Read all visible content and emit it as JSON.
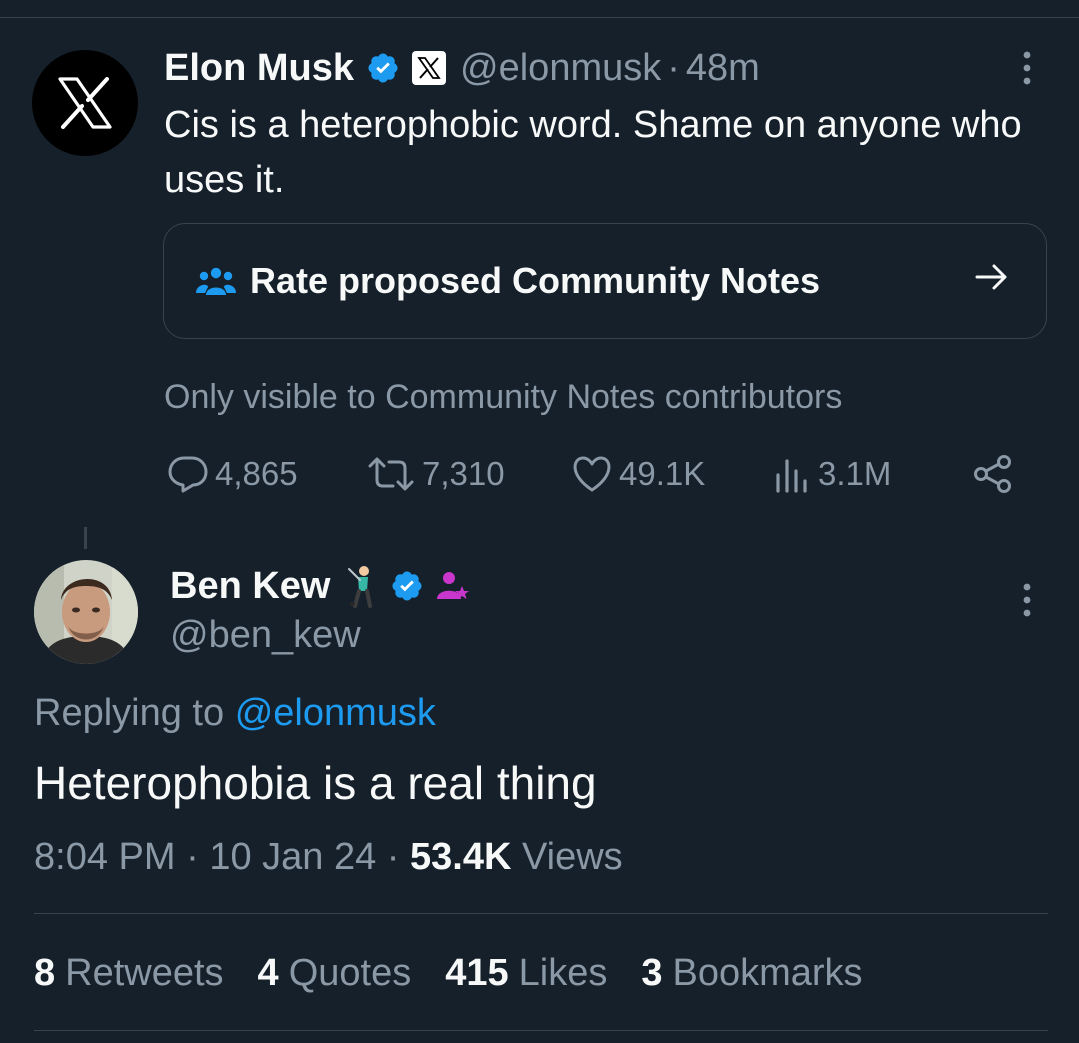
{
  "parent_tweet": {
    "author_name": "Elon Musk",
    "handle": "@elonmusk",
    "separator": "·",
    "time_ago": "48m",
    "text": "Cis is a heterophobic word. Shame on anyone who uses it.",
    "community_notes_label": "Rate proposed Community Notes",
    "visibility_note": "Only visible to Community Notes contributors",
    "actions": {
      "replies": "4,865",
      "retweets": "7,310",
      "likes": "49.1K",
      "views": "3.1M"
    },
    "icons": [
      "x-logo-icon",
      "verified-badge-icon",
      "affiliate-x-badge-icon",
      "more-options-icon",
      "community-icon",
      "arrow-right-icon",
      "reply-icon",
      "retweet-icon",
      "like-icon",
      "views-icon",
      "share-icon"
    ]
  },
  "reply_tweet": {
    "author_name": "Ben Kew",
    "handle": "@ben_kew",
    "replying_prefix": "Replying to",
    "replying_to": "@elonmusk",
    "text": "Heterophobia is a real thing",
    "time": "8:04 PM",
    "separator": "·",
    "date": "10 Jan 24",
    "views_count": "53.4K",
    "views_label": "Views",
    "stats": {
      "retweets_count": "8",
      "retweets_label": "Retweets",
      "quotes_count": "4",
      "quotes_label": "Quotes",
      "likes_count": "415",
      "likes_label": "Likes",
      "bookmarks_count": "3",
      "bookmarks_label": "Bookmarks"
    },
    "icons": [
      "avatar",
      "golfer-emoji-icon",
      "verified-badge-icon",
      "person-star-icon",
      "more-options-icon"
    ]
  },
  "colors": {
    "background": "#15202b",
    "text_primary": "#f7f9f9",
    "text_secondary": "#8b98a5",
    "accent_blue": "#1d9bf0",
    "border": "#38444d",
    "purple_badge": "#c936cc"
  }
}
